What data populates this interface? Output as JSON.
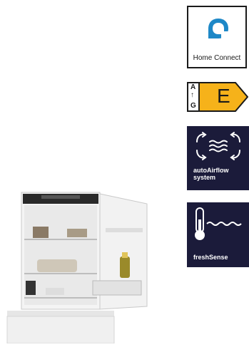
{
  "badges": {
    "home_connect": {
      "label": "Home Connect",
      "icon": "home-connect-logo-icon"
    },
    "energy": {
      "scale_top": "A",
      "scale_bottom": "G",
      "class_letter": "E",
      "color": "#f6b21a"
    },
    "auto_airflow": {
      "line1": "autoAirflow",
      "line2": "system",
      "icon": "airflow-arrows-icon",
      "color": "#1b1b3a"
    },
    "fresh_sense": {
      "label": "freshSense",
      "icon": "thermometer-wave-icon",
      "color": "#1b1b3a"
    }
  }
}
